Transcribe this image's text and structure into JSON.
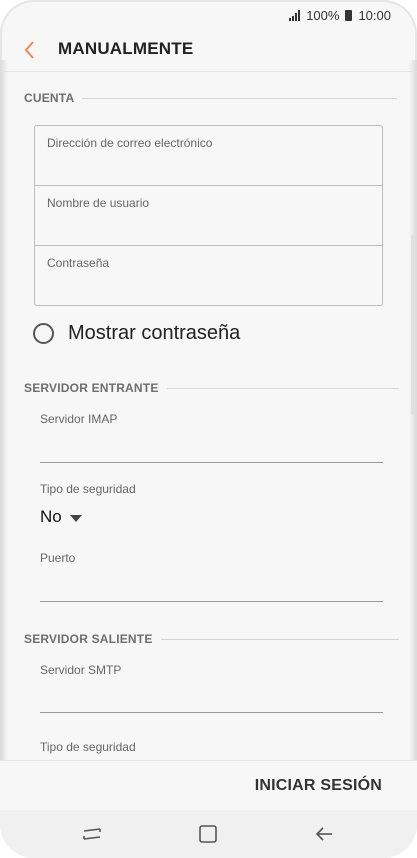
{
  "status_bar": {
    "battery": "100%",
    "time": "10:00"
  },
  "header": {
    "title": "MANUALMENTE",
    "back_icon": "chevron-left-icon",
    "accent_color": "#e88a5a"
  },
  "account": {
    "section_title": "CUENTA",
    "fields": [
      {
        "placeholder": "Dirección de correo electrónico",
        "value": ""
      },
      {
        "placeholder": "Nombre de usuario",
        "value": ""
      },
      {
        "placeholder": "Contraseña",
        "value": ""
      }
    ],
    "show_password": {
      "label": "Mostrar contraseña",
      "checked": false
    }
  },
  "incoming": {
    "section_title": "SERVIDOR ENTRANTE",
    "server_label": "Servidor IMAP",
    "security_label": "Tipo de seguridad",
    "security_value": "No",
    "port_label": "Puerto"
  },
  "outgoing": {
    "section_title": "SERVIDOR SALIENTE",
    "server_label": "Servidor SMTP",
    "security_label": "Tipo de seguridad"
  },
  "actions": {
    "login_label": "INICIAR SESIÓN"
  },
  "nav": {
    "recent_icon": "recent-apps-icon",
    "home_icon": "home-icon",
    "back_icon": "back-arrow-icon"
  }
}
